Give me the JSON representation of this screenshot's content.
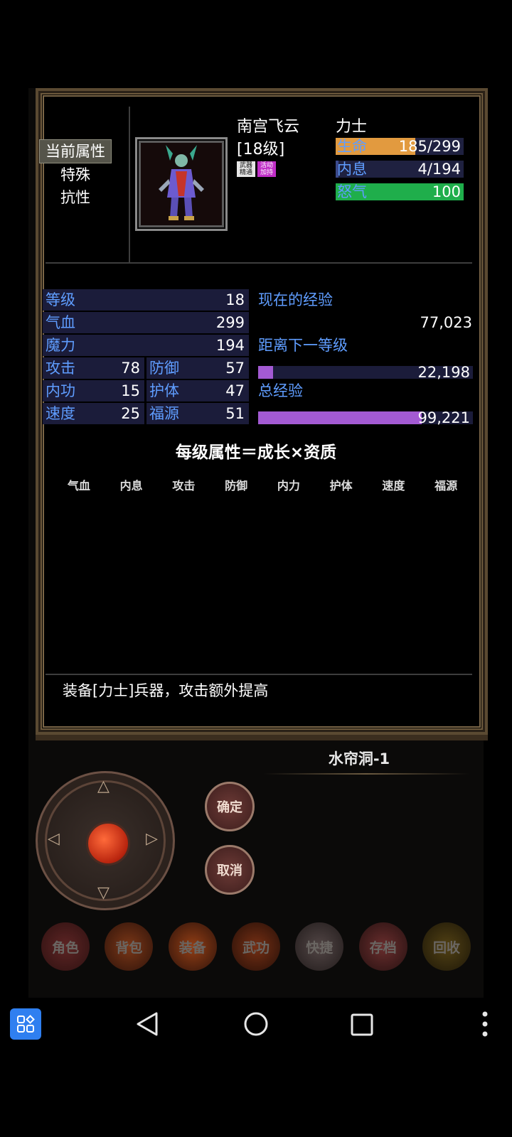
{
  "side_menu": {
    "items": [
      "当前属性",
      "特殊",
      "抗性"
    ],
    "active_index": 0
  },
  "character": {
    "name": "南宫飞云",
    "level": "[18级]",
    "class": "力士",
    "badges": [
      {
        "text": "武器精通",
        "color": "#e6e6e6"
      },
      {
        "text": "活动加持",
        "color": "#c02ec7"
      }
    ]
  },
  "bars": [
    {
      "label": "生命",
      "value": "185/299",
      "fill_fraction": 0.62,
      "color": "#e29a3f"
    },
    {
      "label": "内息",
      "value": "4/194",
      "fill_fraction": 0.02,
      "color": "#3b4a8c"
    },
    {
      "label": "怒气",
      "value": "100",
      "fill_fraction": 1.0,
      "color": "#1fae4b"
    }
  ],
  "stats": {
    "level": {
      "label": "等级",
      "value": "18"
    },
    "hp": {
      "label": "气血",
      "value": "299"
    },
    "mp": {
      "label": "魔力",
      "value": "194"
    },
    "attack": {
      "label": "攻击",
      "value": "78"
    },
    "defense": {
      "label": "防御",
      "value": "57"
    },
    "inner": {
      "label": "内功",
      "value": "15"
    },
    "guard": {
      "label": "护体",
      "value": "47"
    },
    "speed": {
      "label": "速度",
      "value": "25"
    },
    "fortune": {
      "label": "福源",
      "value": "51"
    }
  },
  "experience": {
    "current_label": "现在的经验",
    "current_value": "77,023",
    "next_label": "距离下一等级",
    "next_value": "22,198",
    "next_fill_fraction": 0.07,
    "total_label": "总经验",
    "total_value": "99,221",
    "total_fill_fraction": 0.76
  },
  "formula": "每级属性＝成长×资质",
  "growth_headers": [
    "气血",
    "内息",
    "攻击",
    "防御",
    "内力",
    "护体",
    "速度",
    "福源"
  ],
  "description": "装备[力士]兵器，攻击额外提高",
  "map_name": "水帘洞-1",
  "buttons": {
    "confirm": "确定",
    "cancel": "取消"
  },
  "bottom_menu": [
    "角色",
    "背包",
    "装备",
    "武功",
    "快捷",
    "存档",
    "回收"
  ],
  "colors": {
    "label_blue": "#5f9dff",
    "stat_bg": "#1b1c3a",
    "exp_purple": "#a35ad3"
  }
}
